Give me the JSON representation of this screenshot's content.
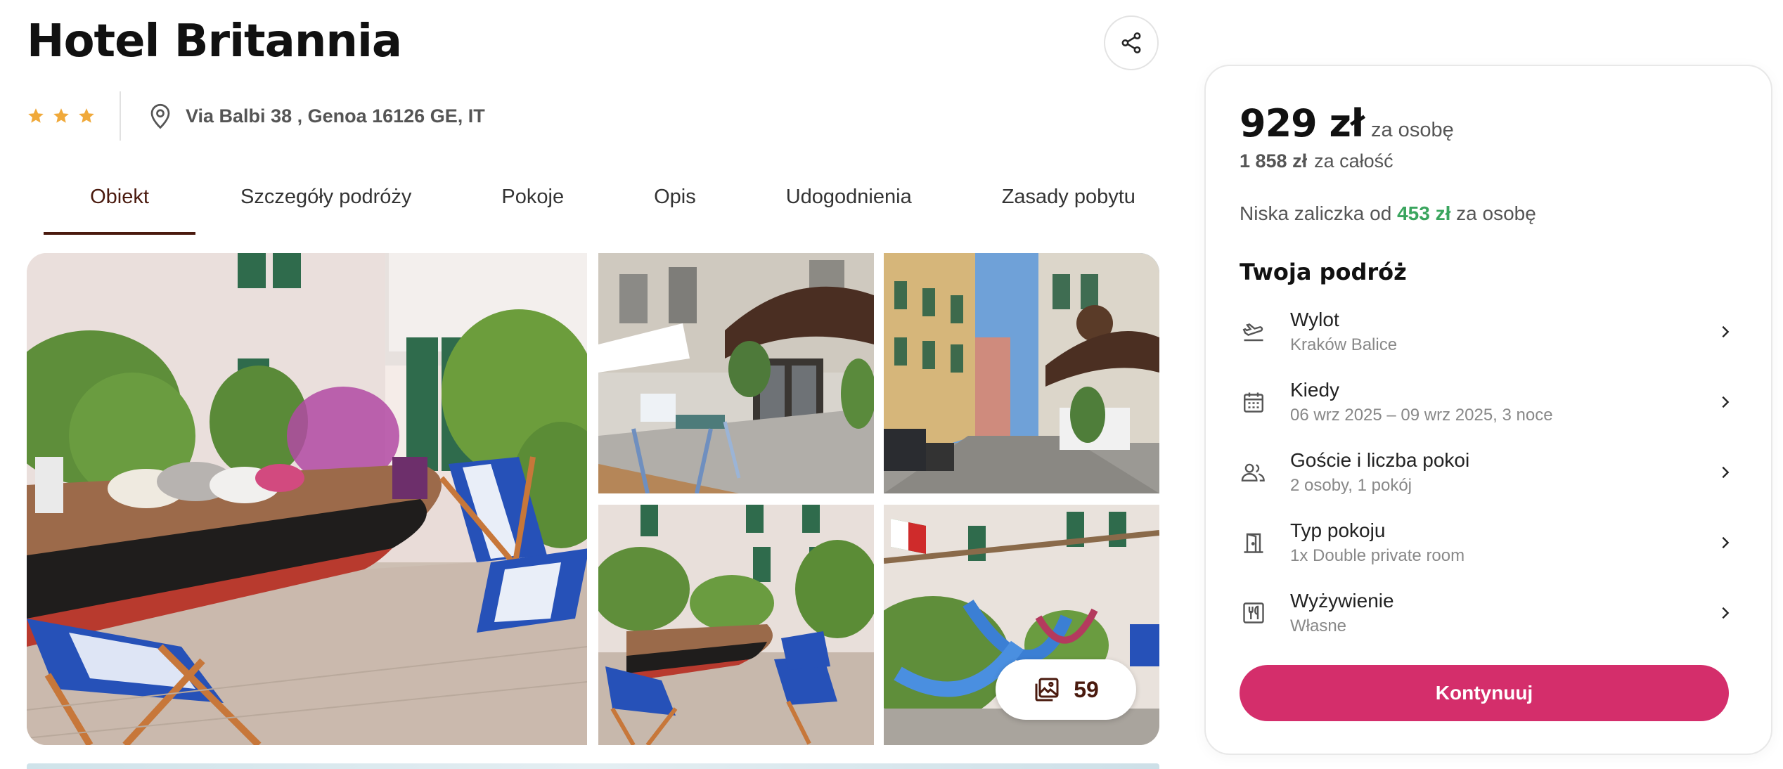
{
  "hotel": {
    "name": "Hotel Britannia",
    "stars": 3,
    "address": "Via Balbi 38 , Genoa 16126 GE, IT"
  },
  "tabs": [
    {
      "label": "Obiekt",
      "active": true
    },
    {
      "label": "Szczegóły podróży",
      "active": false
    },
    {
      "label": "Pokoje",
      "active": false
    },
    {
      "label": "Opis",
      "active": false
    },
    {
      "label": "Udogodnienia",
      "active": false
    },
    {
      "label": "Zasady pobytu",
      "active": false
    }
  ],
  "gallery": {
    "photo_count": "59"
  },
  "booking": {
    "price": "929 zł",
    "price_unit": "za osobę",
    "total": "1 858 zł",
    "total_unit": "za całość",
    "deposit_prefix": "Niska zaliczka od",
    "deposit_amount": "453 zł",
    "deposit_suffix": "za osobę",
    "trip_title": "Twoja podróż",
    "trip_items": [
      {
        "label": "Wylot",
        "value": "Kraków Balice",
        "icon": "plane-departure-icon"
      },
      {
        "label": "Kiedy",
        "value": "06 wrz 2025 – 09 wrz 2025, 3 noce",
        "icon": "calendar-icon"
      },
      {
        "label": "Goście i liczba pokoi",
        "value": "2 osoby, 1 pokój",
        "icon": "guests-icon"
      },
      {
        "label": "Typ pokoju",
        "value": "1x Double private room",
        "icon": "door-icon"
      },
      {
        "label": "Wyżywienie",
        "value": "Własne",
        "icon": "meal-icon"
      }
    ],
    "continue_label": "Kontynuuj"
  },
  "colors": {
    "accent": "#d42e6b",
    "tab_active": "#4a1a0e",
    "star": "#f0a93a",
    "deposit_green": "#3aa55e"
  }
}
